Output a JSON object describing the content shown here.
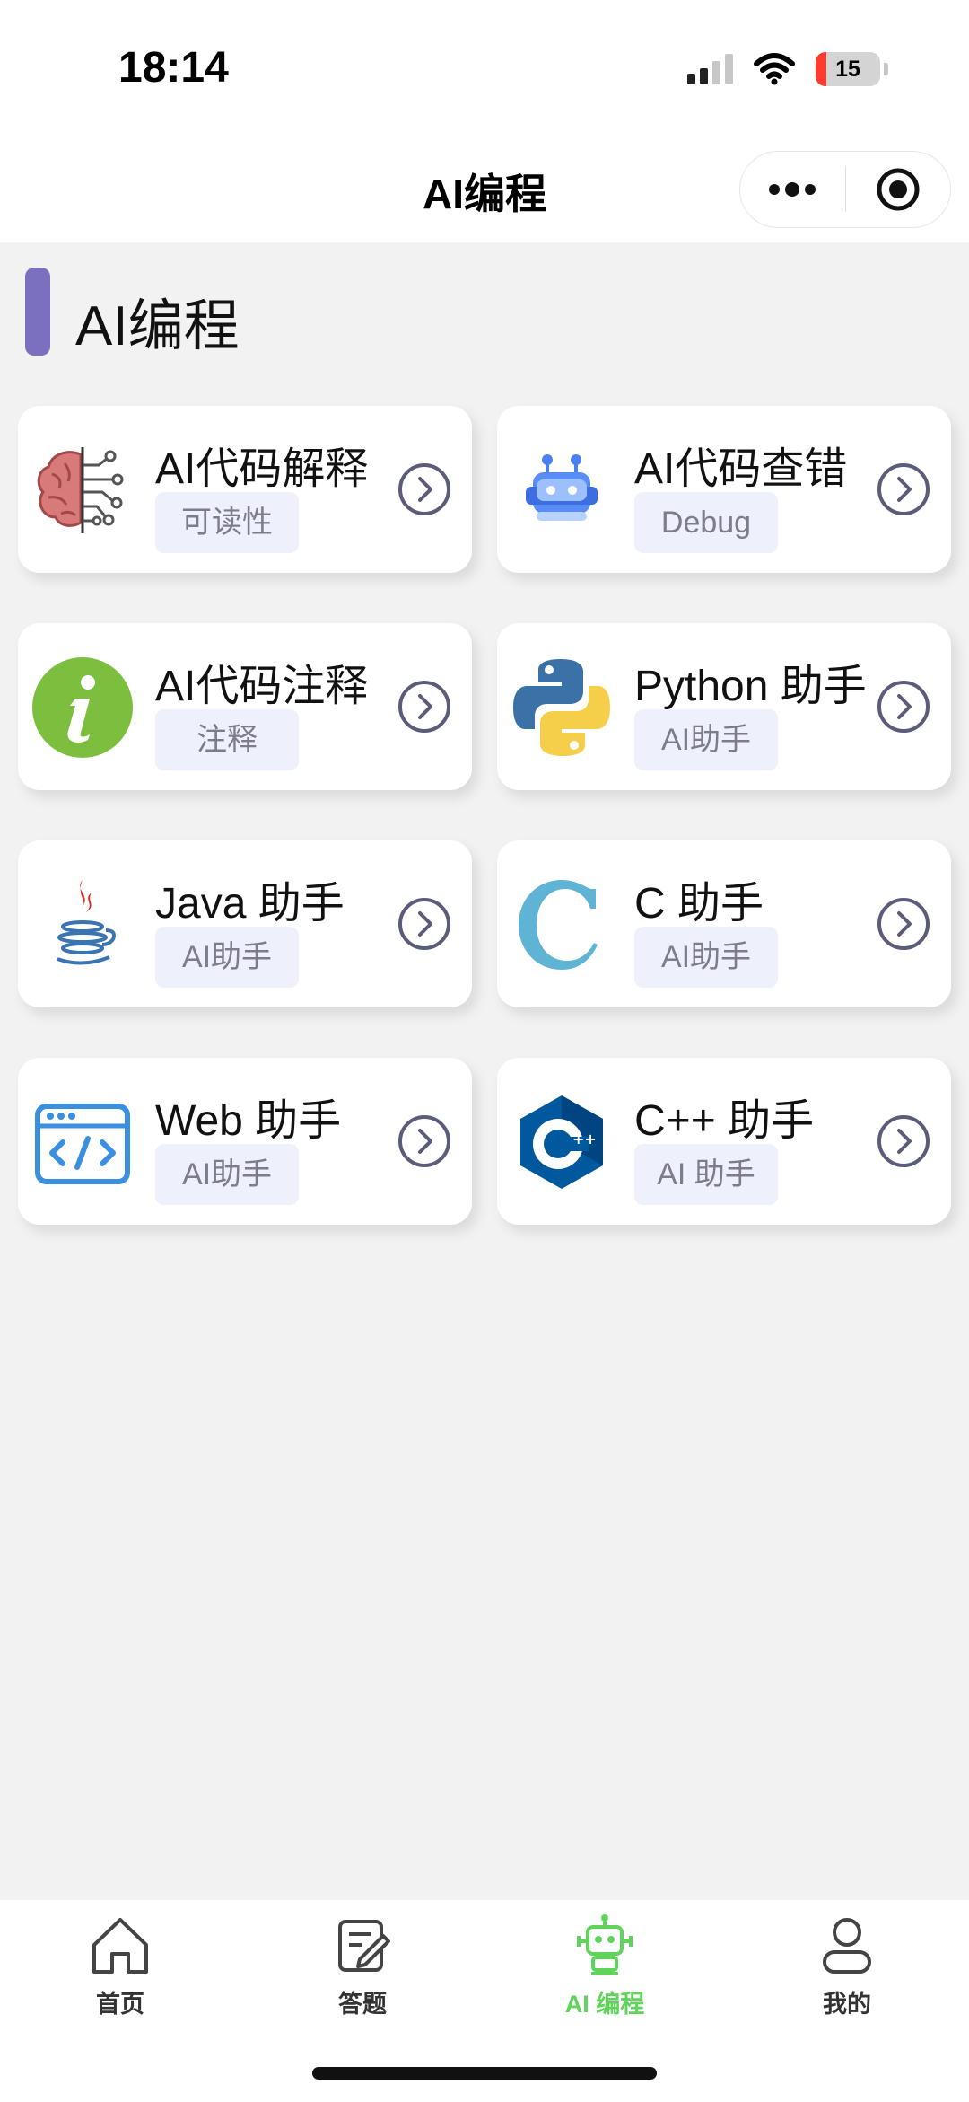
{
  "status_bar": {
    "time": "18:14",
    "battery_level": "15"
  },
  "nav": {
    "title": "AI编程"
  },
  "section": {
    "title": "AI编程",
    "accent_color": "#7b6fc0"
  },
  "cards": [
    {
      "title": "AI代码解释",
      "tag": "可读性",
      "icon": "brain-circuit-icon"
    },
    {
      "title": "AI代码查错",
      "tag": "Debug",
      "icon": "robot-icon"
    },
    {
      "title": "AI代码注释",
      "tag": "注释",
      "icon": "info-icon"
    },
    {
      "title": "Python 助手",
      "tag": "AI助手",
      "icon": "python-logo-icon"
    },
    {
      "title": "Java 助手",
      "tag": "AI助手",
      "icon": "java-logo-icon"
    },
    {
      "title": "C 助手",
      "tag": "AI助手",
      "icon": "c-logo-icon"
    },
    {
      "title": "Web 助手",
      "tag": "AI助手",
      "icon": "web-code-icon"
    },
    {
      "title": "C++ 助手",
      "tag": "AI 助手",
      "icon": "cpp-logo-icon"
    }
  ],
  "tabs": [
    {
      "label": "首页",
      "icon": "home-icon"
    },
    {
      "label": "答题",
      "icon": "edit-note-icon"
    },
    {
      "label": "AI 编程",
      "icon": "robot-icon",
      "active": true,
      "color": "#5fd35a"
    },
    {
      "label": "我的",
      "icon": "user-icon"
    }
  ]
}
